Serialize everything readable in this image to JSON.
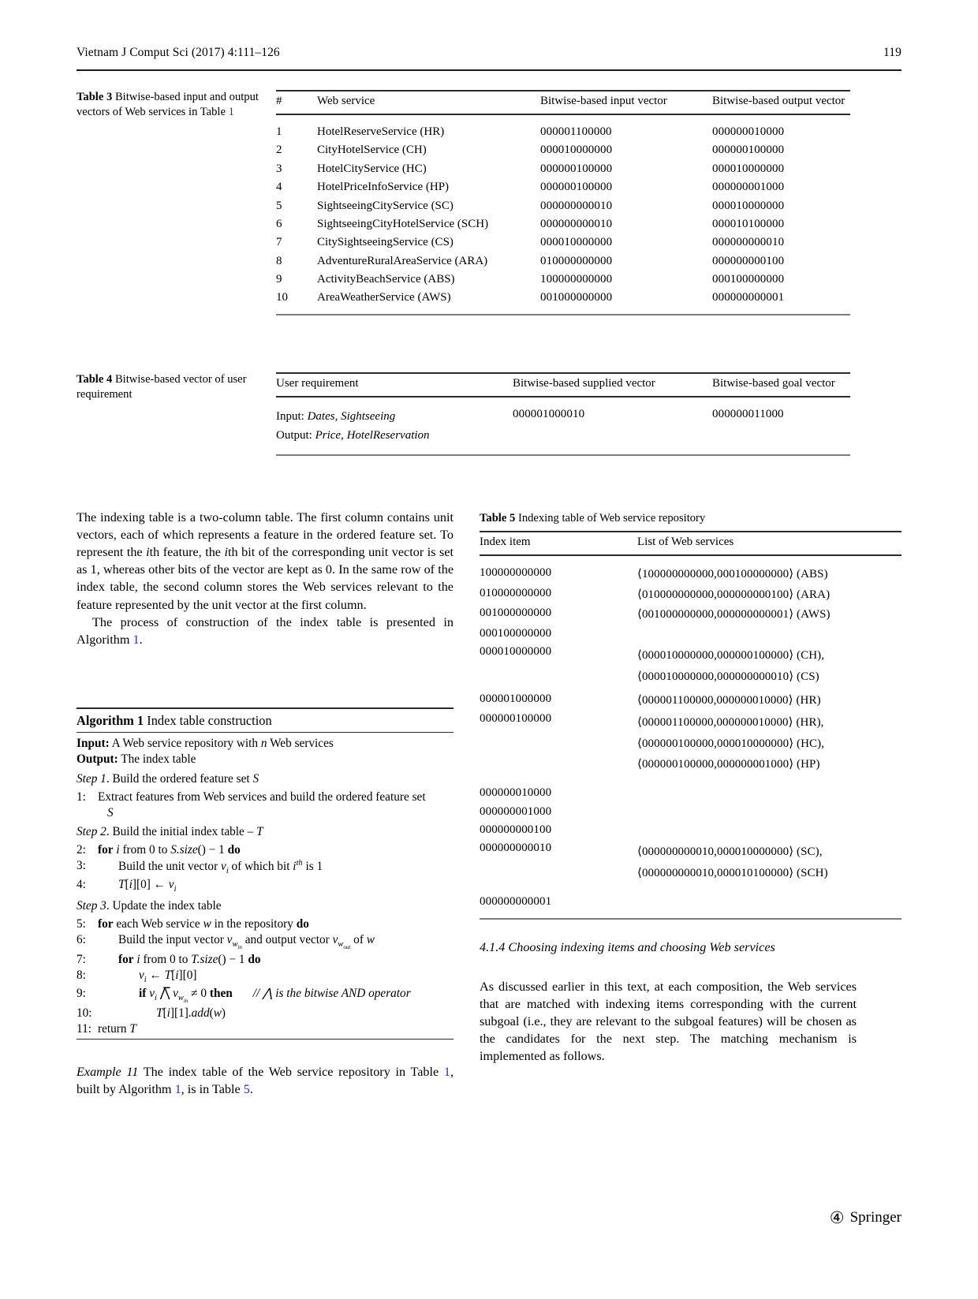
{
  "header": {
    "journal_ref": "Vietnam J Comput Sci (2017) 4:111–126",
    "page_number": "119"
  },
  "table3": {
    "caption_label": "Table 3",
    "caption_text": "Bitwise-based input and output vectors of Web services in Table",
    "caption_link": "1",
    "columns": [
      "#",
      "Web service",
      "Bitwise-based input vector",
      "Bitwise-based output vector"
    ],
    "rows": [
      {
        "n": "1",
        "service": "HotelReserveService (HR)",
        "in": "000001100000",
        "out": "000000010000"
      },
      {
        "n": "2",
        "service": "CityHotelService (CH)",
        "in": "000010000000",
        "out": "000000100000"
      },
      {
        "n": "3",
        "service": "HotelCityService (HC)",
        "in": "000000100000",
        "out": "000010000000"
      },
      {
        "n": "4",
        "service": "HotelPriceInfoService (HP)",
        "in": "000000100000",
        "out": "000000001000"
      },
      {
        "n": "5",
        "service": "SightseeingCityService (SC)",
        "in": "000000000010",
        "out": "000010000000"
      },
      {
        "n": "6",
        "service": "SightseeingCityHotelService (SCH)",
        "in": "000000000010",
        "out": "000010100000"
      },
      {
        "n": "7",
        "service": "CitySightseeingService (CS)",
        "in": "000010000000",
        "out": "000000000010"
      },
      {
        "n": "8",
        "service": "AdventureRuralAreaService (ARA)",
        "in": "010000000000",
        "out": "000000000100"
      },
      {
        "n": "9",
        "service": "ActivityBeachService (ABS)",
        "in": "100000000000",
        "out": "000100000000"
      },
      {
        "n": "10",
        "service": "AreaWeatherService (AWS)",
        "in": "001000000000",
        "out": "000000000001"
      }
    ]
  },
  "table4": {
    "caption_label": "Table 4",
    "caption_text": "Bitwise-based vector of user requirement",
    "columns": [
      "User requirement",
      "Bitwise-based supplied vector",
      "Bitwise-based goal vector"
    ],
    "row": {
      "input_label": "Input:",
      "input_value": "Dates, Sightseeing",
      "output_label": "Output:",
      "output_value": "Price, HotelReservation",
      "supplied": "000001000010",
      "goal": "000000011000"
    }
  },
  "body_left": {
    "para1": "The indexing table is a two-column table. The first column contains unit vectors, each of which represents a feature in the ordered feature set. To represent the ith feature, the ith bit of the corresponding unit vector is set as 1, whereas other bits of the vector are kept as 0. In the same row of the index table, the second column stores the Web services relevant to the feature represented by the unit vector at the first column.",
    "para2_pre": "The process of construction of the index table is presented in Algorithm",
    "para2_link": "1",
    "para2_post": "."
  },
  "algorithm": {
    "title_label": "Algorithm 1",
    "title_text": "Index table construction",
    "input_label": "Input:",
    "input_text": "A Web service repository with n Web services",
    "output_label": "Output:",
    "output_text": "The index table",
    "step1": "Step 1. Build the ordered feature set S",
    "step2": "Step 2. Build the initial index table – T",
    "step3": "Step 3. Update the index table",
    "lines": [
      {
        "num": "1:",
        "text": "Extract features from Web services and build the ordered feature set"
      },
      {
        "num": "",
        "text": "S"
      },
      {
        "num": "2:",
        "text": "for i from 0 to S.size() − 1 do"
      },
      {
        "num": "3:",
        "text": "Build the unit vector vi of which bit ith is 1"
      },
      {
        "num": "4:",
        "text": "T[i][0] ← vi"
      },
      {
        "num": "5:",
        "text": "for each Web service w in the repository do"
      },
      {
        "num": "6:",
        "text": "Build the input vector vwin and output vector vwout of w"
      },
      {
        "num": "7:",
        "text": "for i from 0 to T.size() − 1 do"
      },
      {
        "num": "8:",
        "text": "vi ← T[i][0]"
      },
      {
        "num": "9:",
        "text": "if vi ⋀ vwin ≠ 0 then"
      },
      {
        "num": "",
        "text": "// ⋀ is the bitwise AND operator"
      },
      {
        "num": "10:",
        "text": "T[i][1].add(w)"
      },
      {
        "num": "11:",
        "text": "return T"
      }
    ]
  },
  "example11": {
    "label": "Example 11",
    "text_pre": "The index table of the Web service repository in Table",
    "link1": "1",
    "text_mid": ", built by Algorithm",
    "link2": "1",
    "text_mid2": ", is in Table",
    "link3": "5",
    "text_post": "."
  },
  "table5": {
    "caption_label": "Table 5",
    "caption_text": "Indexing table of Web service repository",
    "columns": [
      "Index item",
      "List of Web services"
    ],
    "rows": [
      {
        "index": "100000000000",
        "services": [
          "⟨100000000000,000100000000⟩ (ABS)"
        ]
      },
      {
        "index": "010000000000",
        "services": [
          "⟨010000000000,000000000100⟩ (ARA)"
        ]
      },
      {
        "index": "001000000000",
        "services": [
          "⟨001000000000,000000000001⟩ (AWS)"
        ]
      },
      {
        "index": "000100000000",
        "services": []
      },
      {
        "index": "000010000000",
        "services": [
          "⟨000010000000,000000100000⟩ (CH),",
          "⟨000010000000,000000000010⟩ (CS)"
        ]
      },
      {
        "index": "000001000000",
        "services": [
          "⟨000001100000,000000010000⟩ (HR)"
        ]
      },
      {
        "index": "000000100000",
        "services": [
          "⟨000001100000,000000010000⟩ (HR),",
          "⟨000000100000,000010000000⟩ (HC),",
          "⟨000000100000,000000001000⟩ (HP)"
        ]
      },
      {
        "index": "000000010000",
        "services": []
      },
      {
        "index": "000000001000",
        "services": []
      },
      {
        "index": "000000000100",
        "services": []
      },
      {
        "index": "000000000010",
        "services": [
          "⟨000000000010,000010000000⟩ (SC),",
          "⟨000000000010,000010100000⟩ (SCH)"
        ]
      },
      {
        "index": "000000000001",
        "services": []
      }
    ]
  },
  "section": {
    "heading": "4.1.4 Choosing indexing items and choosing Web services",
    "para": "As discussed earlier in this text, at each composition, the Web services that are matched with indexing items corresponding with the current subgoal (i.e., they are relevant to the subgoal features) will be chosen as the candidates for the next step. The matching mechanism is implemented as follows."
  },
  "footer": {
    "publisher": "Springer",
    "logo_glyph": "④"
  }
}
